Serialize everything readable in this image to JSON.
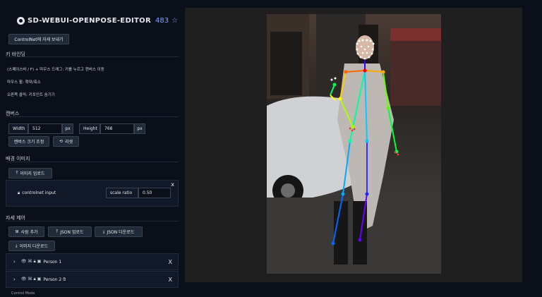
{
  "header": {
    "title": "SD-WEBUI-OPENPOSE-EDITOR",
    "stars": "483"
  },
  "controlnet_button": "ControlNet에 자세 보내기",
  "keybind": {
    "title": "키 바인딩",
    "lines": [
      {
        "key": "(스페이스바 / F) + 마우스 드래그:",
        "desc": "키를 누르고 캔버스 이동"
      },
      {
        "key": "마우스 휠:",
        "desc": "확대/축소"
      },
      {
        "key": "오른쪽 클릭:",
        "desc": "키포인트 숨기기"
      }
    ]
  },
  "canvas": {
    "title": "캔버스",
    "width_label": "Width",
    "width_value": "512",
    "width_unit": "px",
    "height_label": "Height",
    "height_value": "768",
    "height_unit": "px",
    "resize_button": "캔버스 크기 조정",
    "reset_button": "리셋"
  },
  "background": {
    "title": "배경 이미지",
    "upload_button": "이미지 업로드",
    "controlnet_input_label": "controlnet input",
    "scale_ratio_label": "scale ratio",
    "scale_ratio_value": "0.50",
    "close": "x"
  },
  "pose": {
    "title": "자세 제어",
    "add_person_button": "사람 추가",
    "json_upload_button": "JSON 업로드",
    "json_download_button": "JSON 다운로드",
    "image_download_button": "이미지 다운로드",
    "persons": [
      {
        "name": "Person 1",
        "close": "X"
      },
      {
        "name": "Person 2",
        "close": "X"
      }
    ]
  },
  "footer": {
    "label": "Control Mode"
  },
  "colors": {
    "accent": "#7aa2ff",
    "panel_bg": "#0b0f19",
    "canvas_bg": "#1f1f1f"
  }
}
